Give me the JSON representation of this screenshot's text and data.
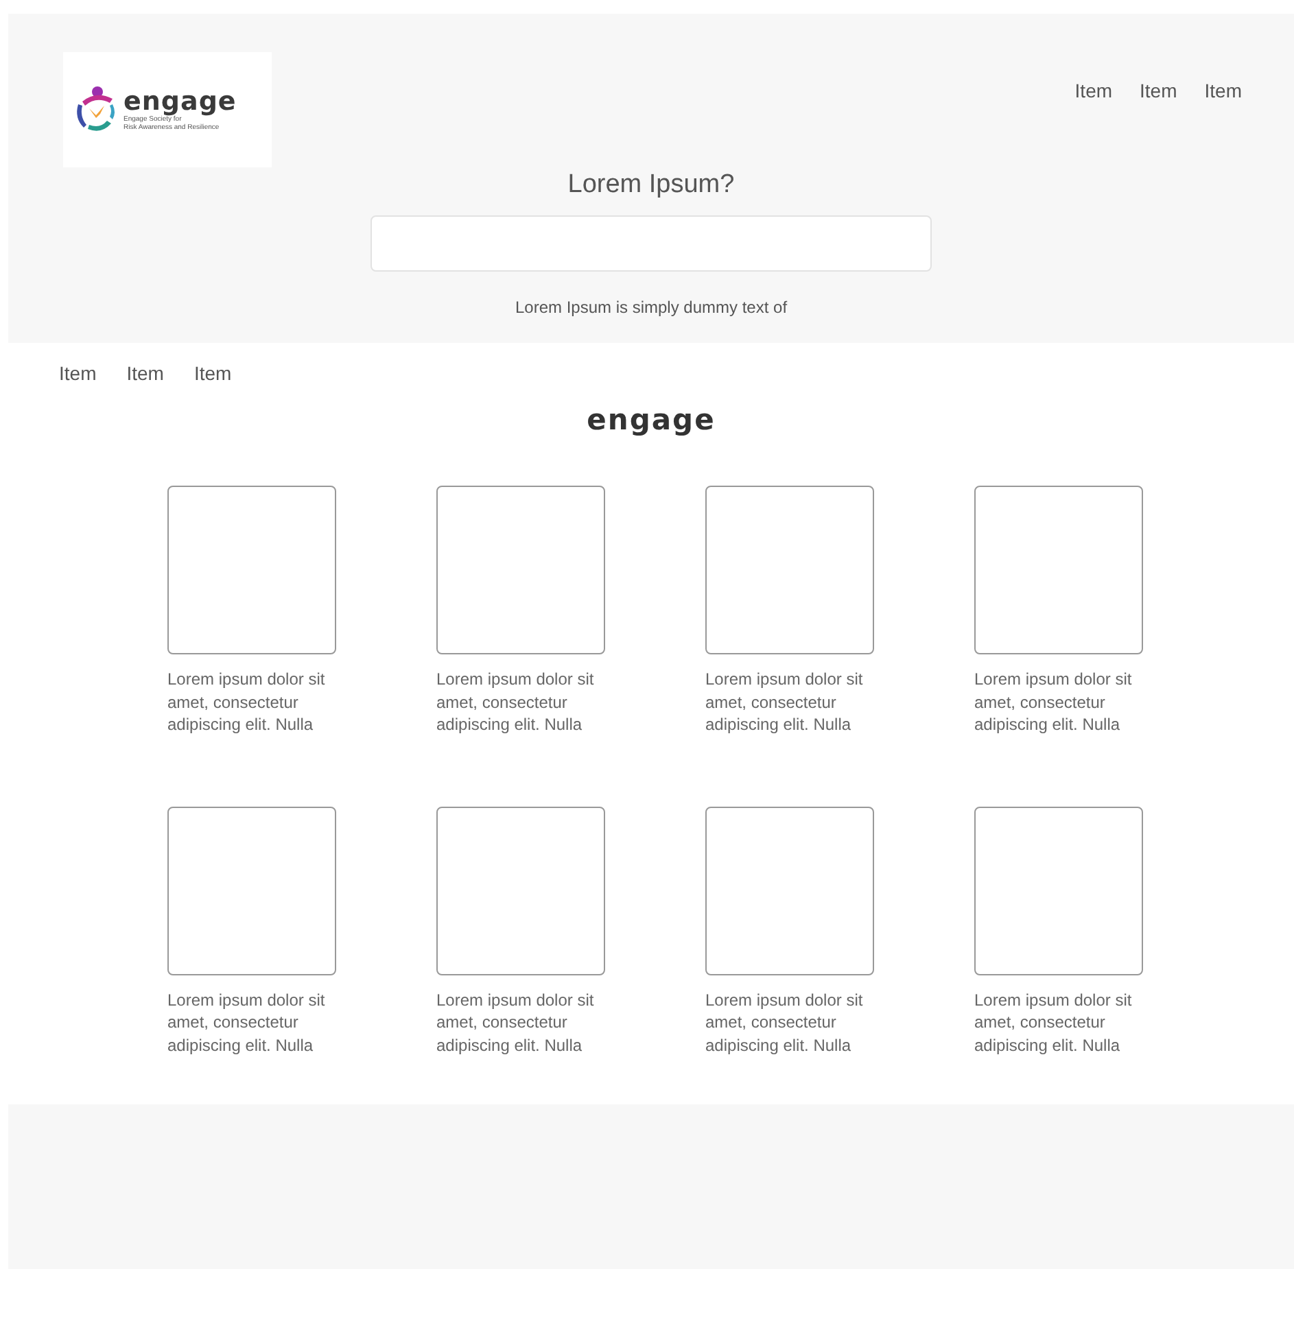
{
  "logo": {
    "wordmark": "engage",
    "tagline_lines": [
      "Engage Society for",
      "Risk Awareness and Resilience"
    ]
  },
  "top_nav": [
    "Item",
    "Item",
    "Item"
  ],
  "hero": {
    "title": "Lorem Ipsum?",
    "subtitle": "Lorem Ipsum is simply dummy text of"
  },
  "secondary_nav": [
    "Item",
    "Item",
    "Item"
  ],
  "section_title": "engage",
  "cards": [
    {
      "caption": "Lorem ipsum dolor sit amet, consectetur adipiscing elit. Nulla"
    },
    {
      "caption": "Lorem ipsum dolor sit amet, consectetur adipiscing elit. Nulla"
    },
    {
      "caption": "Lorem ipsum dolor sit amet, consectetur adipiscing elit. Nulla"
    },
    {
      "caption": "Lorem ipsum dolor sit amet, consectetur adipiscing elit. Nulla"
    },
    {
      "caption": "Lorem ipsum dolor sit amet, consectetur adipiscing elit. Nulla"
    },
    {
      "caption": "Lorem ipsum dolor sit amet, consectetur adipiscing elit. Nulla"
    },
    {
      "caption": "Lorem ipsum dolor sit amet, consectetur adipiscing elit. Nulla"
    },
    {
      "caption": "Lorem ipsum dolor sit amet, consectetur adipiscing elit. Nulla"
    }
  ]
}
